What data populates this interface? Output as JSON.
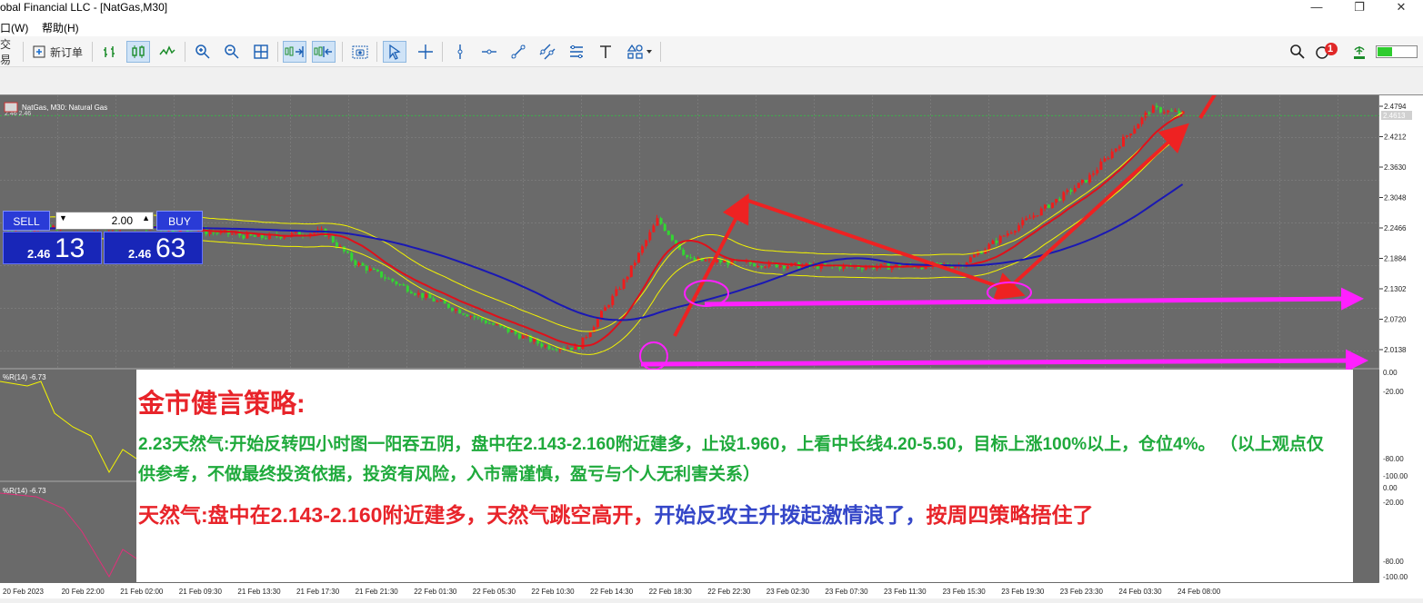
{
  "window": {
    "title": "obal Financial LLC - [NatGas,M30]",
    "controls": [
      "—",
      "❐",
      "✕"
    ]
  },
  "menu": {
    "items": [
      "口(W)",
      "帮助(H)"
    ]
  },
  "toolbar": {
    "trade_label": "交易",
    "new_order_label": "新订单",
    "notification_count": "1"
  },
  "chart": {
    "header": "NatGas, M30:  Natural Gas",
    "header_sub": "2.46 2.46",
    "price_current": "2.4613",
    "price_axis": [
      "2.4794",
      "2.4212",
      "2.3630",
      "2.3048",
      "2.2466",
      "2.1884",
      "2.1302",
      "2.0720",
      "2.0138"
    ],
    "time_axis": [
      "20 Feb 2023",
      "20 Feb 22:00",
      "21 Feb 02:00",
      "21 Feb 09:30",
      "21 Feb 13:30",
      "21 Feb 17:30",
      "21 Feb 21:30",
      "22 Feb 01:30",
      "22 Feb 05:30",
      "22 Feb 10:30",
      "22 Feb 14:30",
      "22 Feb 18:30",
      "22 Feb 22:30",
      "23 Feb 02:30",
      "23 Feb 07:30",
      "23 Feb 11:30",
      "23 Feb 15:30",
      "23 Feb 19:30",
      "23 Feb 23:30",
      "24 Feb 03:30",
      "24 Feb 08:00"
    ],
    "indicator1": {
      "label": "%R(14) -6.73",
      "levels": [
        "0.00",
        "-20.00",
        "-80.00",
        "-100.00"
      ]
    },
    "indicator2": {
      "label": "%R(14) -6.73",
      "levels": [
        "0.00",
        "-20.00",
        "-80.00",
        "-100.00"
      ]
    },
    "colors": {
      "background": "#6a6a6a",
      "bull": "#ef1c1c",
      "bear": "#33d632",
      "bands": "#f4f400",
      "ma_fast": "#e0101a",
      "ma_slow": "#1a18b4",
      "annotation_red": "#ee2222",
      "annotation_magenta": "#ff20ff"
    }
  },
  "trade_panel": {
    "sell_label": "SELL",
    "buy_label": "BUY",
    "lot": "2.00",
    "sell_prefix": "2.46",
    "sell_big": "13",
    "buy_prefix": "2.46",
    "buy_big": "63"
  },
  "commentary": {
    "headline": "金市健言策略:",
    "body": "2.23天然气:开始反转四小时图一阳吞五阴，盘中在2.143-2.160附近建多，止设1.960，上看中长线4.20-5.50，目标上涨100%以上，仓位4%。 （以上观点仅供参考，不做最终投资依据，投资有风险，入市需谨慎，盈亏与个人无利害关系）",
    "update_red": "天然气:盘中在2.143-2.160附近建多，天然气跳空高开，",
    "update_blue": "开始反攻主升拨起激情浪了，",
    "update_red2": "按周四策略捂住了"
  }
}
